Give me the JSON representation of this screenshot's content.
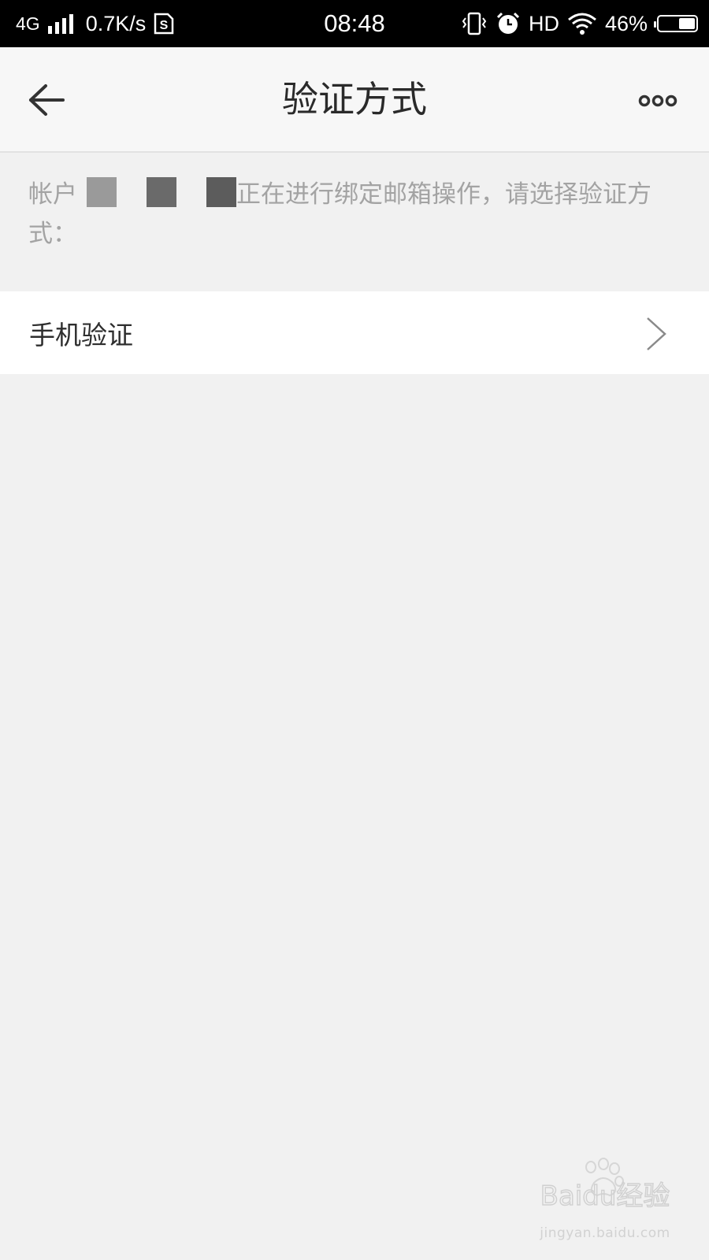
{
  "status_bar": {
    "network": "4G",
    "speed": "0.7K/s",
    "sim_badge": "S",
    "time": "08:48",
    "hd": "HD",
    "battery_percent": "46%",
    "battery_level": 0.46
  },
  "nav": {
    "title": "验证方式"
  },
  "description": {
    "prefix": "帐户",
    "suffix": "正在进行绑定邮箱操作，请选择验证方式："
  },
  "list": {
    "items": [
      {
        "label": "手机验证"
      }
    ]
  },
  "watermark": {
    "brand": "Baidu经验",
    "url": "jingyan.baidu.com"
  },
  "colors": {
    "status_bar_bg": "#000000",
    "nav_bg": "#f7f7f7",
    "page_bg": "#f1f1f1",
    "list_bg": "#ffffff",
    "description_text": "#a3a3a3",
    "title_text": "#2a2a2a"
  },
  "icons": {
    "back": "arrow-left-icon",
    "more": "more-dots-icon",
    "chevron": "chevron-right-icon",
    "signal": "signal-bars-icon",
    "vibrate": "vibrate-icon",
    "alarm": "alarm-clock-icon",
    "wifi": "wifi-icon",
    "battery": "battery-icon"
  }
}
